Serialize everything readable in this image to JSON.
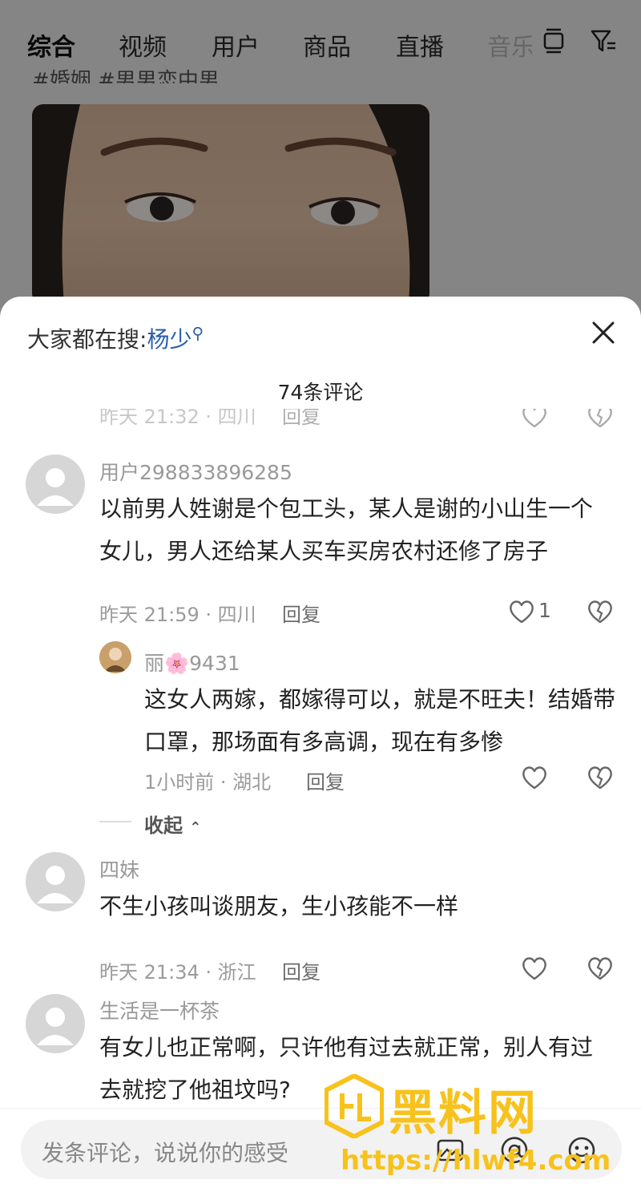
{
  "background": {
    "tabs": [
      "综合",
      "视频",
      "用户",
      "商品",
      "直播",
      "音乐"
    ],
    "subtitle": "#婚姻 #男男恋中男"
  },
  "sheet": {
    "search_prefix": "大家都在搜:",
    "search_keyword": "杨少",
    "comment_count": "74条评论"
  },
  "comments": {
    "partial_top": {
      "time": "昨天 21:32 · 四川",
      "reply": "回复"
    },
    "c1": {
      "user": "用户298833896285",
      "text": "以前男人姓谢是个包工头，某人是谢的小山生一个女儿，男人还给某人买车买房农村还修了房子",
      "time": "昨天 21:59 · 四川",
      "reply": "回复",
      "likes": "1"
    },
    "c1_reply": {
      "user": "丽🌸9431",
      "text": "这女人两嫁，都嫁得可以，就是不旺夫！结婚带口罩，那场面有多高调，现在有多惨",
      "time": "1小时前 · 湖北",
      "reply": "回复"
    },
    "collapse_label": "收起",
    "c2": {
      "user": "四妹",
      "text": "不生小孩叫谈朋友，生小孩能不一样",
      "time": "昨天 21:34 · 浙江",
      "reply": "回复"
    },
    "c3": {
      "user": "生活是一杯茶",
      "text": "有女儿也正常啊，只许他有过去就正常，别人有过去就挖了他祖坟吗?"
    }
  },
  "input": {
    "placeholder": "发条评论，说说你的感受"
  },
  "watermark": {
    "title": "黑料网",
    "url": "https://hlwf4.com"
  },
  "colors": {
    "accent_blue": "#2b5ea8",
    "watermark_yellow": "#f7c21c"
  },
  "icons": [
    "layers-icon",
    "filter-icon",
    "close-icon",
    "heart-icon",
    "broken-heart-icon",
    "image-icon",
    "at-icon",
    "emoji-icon",
    "default-avatar-icon"
  ]
}
